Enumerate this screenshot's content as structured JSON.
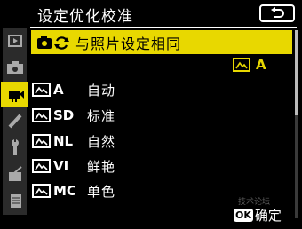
{
  "header": {
    "title": "设定优化校准",
    "back_icon": "return-icon"
  },
  "tabs": [
    {
      "icon": "playback-icon",
      "active": false
    },
    {
      "icon": "camera-icon",
      "active": false
    },
    {
      "icon": "movie-icon",
      "active": true
    },
    {
      "icon": "pencil-icon",
      "active": false
    },
    {
      "icon": "wrench-icon",
      "active": false
    },
    {
      "icon": "retouch-icon",
      "active": false
    },
    {
      "icon": "my-menu-icon",
      "active": false
    }
  ],
  "selected": {
    "label": "与照片设定相同",
    "current_value": "A"
  },
  "items": [
    {
      "code": "A",
      "label": "自动"
    },
    {
      "code": "SD",
      "label": "标准"
    },
    {
      "code": "NL",
      "label": "自然"
    },
    {
      "code": "VI",
      "label": "鲜艳"
    },
    {
      "code": "MC",
      "label": "单色"
    }
  ],
  "footer": {
    "ok_key": "OK",
    "ok_label": "确定"
  },
  "watermark": "技术论坛",
  "colors": {
    "accent": "#e8d800",
    "background": "#000000"
  }
}
